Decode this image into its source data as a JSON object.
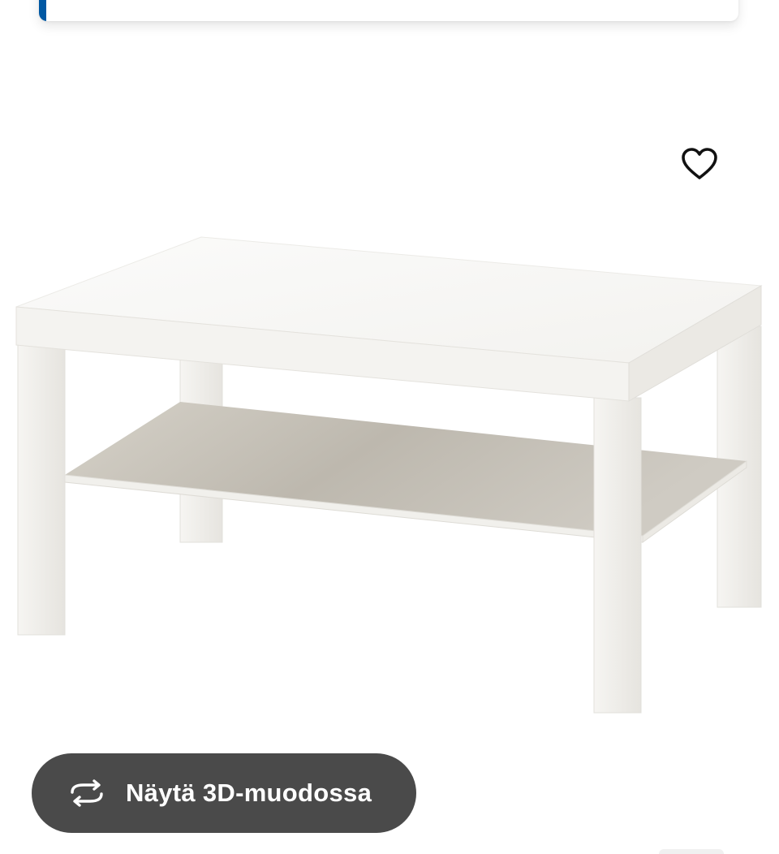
{
  "product": {
    "image_alt": "white coffee table with lower shelf",
    "favourite_icon": "heart-outline-icon"
  },
  "view3d": {
    "label": "Näytä 3D-muodossa",
    "icon": "rotate-3d-icon",
    "background_color": "#4a4a4a"
  },
  "top_card": {
    "accent_color": "#0058a3"
  }
}
